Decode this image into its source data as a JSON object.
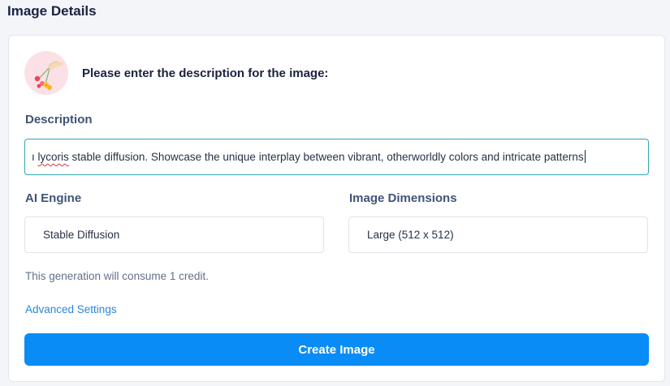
{
  "page": {
    "title": "Image Details"
  },
  "prompt": {
    "heading": "Please enter the description for the image:"
  },
  "avatar": {
    "icon": "flower-hand-illustration-icon"
  },
  "description": {
    "label": "Description",
    "value_prefix": "ı ",
    "value_misspelled_word": "lycoris",
    "value_rest": " stable diffusion. Showcase the unique interplay between vibrant, otherworldly colors and intricate patterns"
  },
  "engine": {
    "label": "AI Engine",
    "value": "Stable Diffusion"
  },
  "dimensions": {
    "label": "Image Dimensions",
    "value": "Large (512 x 512)"
  },
  "credit_note": "This generation will consume 1 credit.",
  "advanced_link": "Advanced Settings",
  "create_button": "Create Image",
  "colors": {
    "primary_button": "#0a8cf7",
    "link": "#2b86e0",
    "input_focus_border": "#2fa7b0",
    "title": "#1a2240",
    "label": "#3f5478"
  }
}
